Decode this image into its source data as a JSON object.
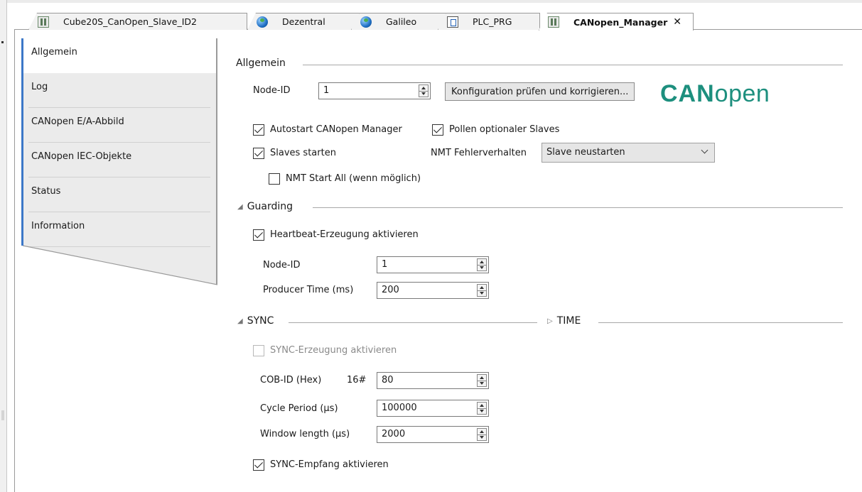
{
  "tabs": [
    {
      "label": "Cube20S_CanOpen_Slave_ID2",
      "icon": "module-icon"
    },
    {
      "label": "Dezentral",
      "icon": "globe-icon"
    },
    {
      "label": "Galileo",
      "icon": "globe-icon"
    },
    {
      "label": "PLC_PRG",
      "icon": "program-icon"
    },
    {
      "label": "CANopen_Manager",
      "icon": "module-icon",
      "close": "✕"
    }
  ],
  "sidebar": {
    "items": [
      {
        "label": "Allgemein"
      },
      {
        "label": "Log"
      },
      {
        "label": "CANopen E/A-Abbild"
      },
      {
        "label": "CANopen IEC-Objekte"
      },
      {
        "label": "Status"
      },
      {
        "label": "Information"
      }
    ]
  },
  "general": {
    "title": "Allgemein",
    "node_id_label": "Node-ID",
    "node_id_value": "1",
    "check_button": "Konfiguration prüfen und korrigieren...",
    "logo_bold": "CAN",
    "logo_light": "open",
    "autostart_label": "Autostart CANopen Manager",
    "autostart_checked": true,
    "poll_label": "Pollen optionaler Slaves",
    "poll_checked": true,
    "start_slaves_label": "Slaves starten",
    "start_slaves_checked": true,
    "nmt_error_label": "NMT Fehlerverhalten",
    "nmt_error_value": "Slave neustarten",
    "nmt_start_all_label": "NMT Start All (wenn möglich)",
    "nmt_start_all_checked": false
  },
  "guarding": {
    "title": "Guarding",
    "heartbeat_label": "Heartbeat-Erzeugung aktivieren",
    "heartbeat_checked": true,
    "node_id_label": "Node-ID",
    "node_id_value": "1",
    "producer_time_label": "Producer Time (ms)",
    "producer_time_value": "200"
  },
  "sync": {
    "title": "SYNC",
    "sync_gen_label": "SYNC-Erzeugung aktivieren",
    "sync_gen_checked": false,
    "cob_id_label": "COB-ID (Hex)",
    "cob_id_prefix": "16#",
    "cob_id_value": "80",
    "cycle_label": "Cycle Period (µs)",
    "cycle_value": "100000",
    "window_label": "Window length (µs)",
    "window_value": "2000",
    "sync_recv_label": "SYNC-Empfang aktivieren",
    "sync_recv_checked": true
  },
  "time": {
    "title": "TIME"
  },
  "colors": {
    "accent": "#3c78c8",
    "logo": "#1d8f7e"
  }
}
